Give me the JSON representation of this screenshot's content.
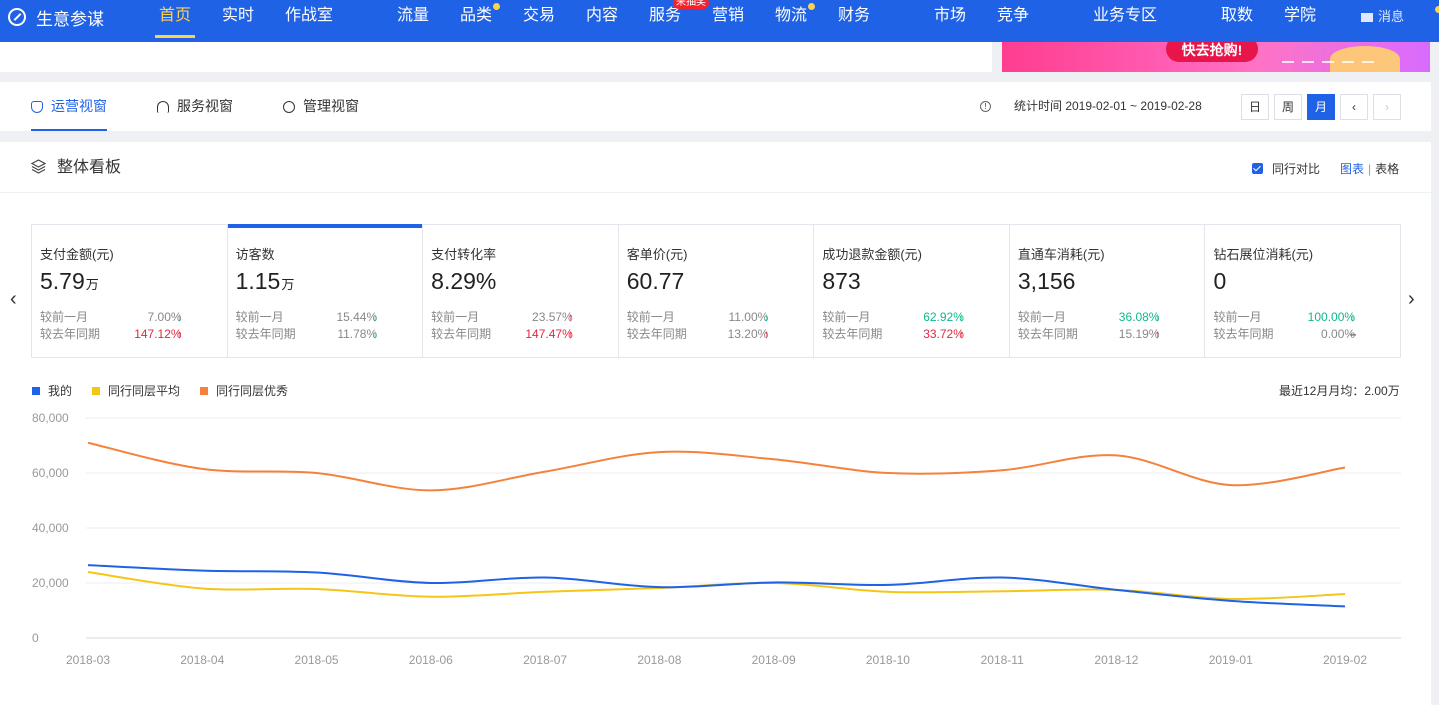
{
  "nav": {
    "brand": "生意参谋",
    "items": [
      {
        "label": "首页",
        "active": true
      },
      {
        "label": "实时"
      },
      {
        "label": "作战室"
      },
      {
        "label": "流量"
      },
      {
        "label": "品类",
        "dot": true
      },
      {
        "label": "交易"
      },
      {
        "label": "内容"
      },
      {
        "label": "服务",
        "badge": "来抽奖"
      },
      {
        "label": "营销"
      },
      {
        "label": "物流",
        "dot": true
      },
      {
        "label": "财务"
      },
      {
        "label": "市场"
      },
      {
        "label": "竞争"
      },
      {
        "label": "业务专区"
      },
      {
        "label": "取数"
      },
      {
        "label": "学院"
      }
    ],
    "message": "消息"
  },
  "banner": {
    "cta": "快去抢购!"
  },
  "view_tabs": [
    {
      "label": "运营视窗",
      "active": true,
      "icon": "shield-icon"
    },
    {
      "label": "服务视窗",
      "icon": "headset-icon"
    },
    {
      "label": "管理视窗",
      "icon": "medal-icon"
    }
  ],
  "stats_range": {
    "label": "统计时间 2019-02-01 ~ 2019-02-28",
    "periods": [
      "日",
      "周",
      "月"
    ],
    "active_period": "月"
  },
  "overview": {
    "title": "整体看板",
    "compare_label": "同行对比",
    "view_chart": "图表",
    "view_table": "表格",
    "separator": "|"
  },
  "metrics": [
    {
      "label": "支付金额(元)",
      "value": "5.79",
      "unit": "万",
      "mom_label": "较前一月",
      "mom": "7.00%",
      "mom_dir": "down",
      "mom_color": "gray",
      "yoy_label": "较去年同期",
      "yoy": "147.12%",
      "yoy_dir": "up",
      "yoy_color": "red"
    },
    {
      "label": "访客数",
      "value": "1.15",
      "unit": "万",
      "selected": true,
      "mom_label": "较前一月",
      "mom": "15.44%",
      "mom_dir": "down",
      "mom_color": "gray",
      "yoy_label": "较去年同期",
      "yoy": "11.78%",
      "yoy_dir": "down",
      "yoy_color": "gray"
    },
    {
      "label": "支付转化率",
      "value": "8.29%",
      "unit": "",
      "mom_label": "较前一月",
      "mom": "23.57%",
      "mom_dir": "up",
      "mom_color": "gray",
      "yoy_label": "较去年同期",
      "yoy": "147.47%",
      "yoy_dir": "up",
      "yoy_color": "red"
    },
    {
      "label": "客单价(元)",
      "value": "60.77",
      "unit": "",
      "mom_label": "较前一月",
      "mom": "11.00%",
      "mom_dir": "down",
      "mom_color": "gray",
      "yoy_label": "较去年同期",
      "yoy": "13.20%",
      "yoy_dir": "up",
      "yoy_color": "gray"
    },
    {
      "label": "成功退款金额(元)",
      "value": "873",
      "unit": "",
      "mom_label": "较前一月",
      "mom": "62.92%",
      "mom_dir": "down",
      "mom_color": "green",
      "yoy_label": "较去年同期",
      "yoy": "33.72%",
      "yoy_dir": "up",
      "yoy_color": "red"
    },
    {
      "label": "直通车消耗(元)",
      "value": "3,156",
      "unit": "",
      "mom_label": "较前一月",
      "mom": "36.08%",
      "mom_dir": "down",
      "mom_color": "green",
      "yoy_label": "较去年同期",
      "yoy": "15.19%",
      "yoy_dir": "up",
      "yoy_color": "gray"
    },
    {
      "label": "钻石展位消耗(元)",
      "value": "0",
      "unit": "",
      "mom_label": "较前一月",
      "mom": "100.00%",
      "mom_dir": "down",
      "mom_color": "green",
      "yoy_label": "较去年同期",
      "yoy": "0.00%",
      "yoy_dir": "flat",
      "yoy_color": "gray"
    }
  ],
  "avg_label": "最近12月月均：2.00万",
  "colors": {
    "accent": "#2062e6",
    "up": "#e4273e",
    "down": "#11b78c"
  },
  "chart_data": {
    "type": "line",
    "categories": [
      "2018-03",
      "2018-04",
      "2018-05",
      "2018-06",
      "2018-07",
      "2018-08",
      "2018-09",
      "2018-10",
      "2018-11",
      "2018-12",
      "2019-01",
      "2019-02"
    ],
    "ylim": [
      0,
      80000
    ],
    "yticks": [
      "0",
      "20,000",
      "40,000",
      "60,000",
      "80,000"
    ],
    "ytick_values": [
      0,
      20000,
      40000,
      60000,
      80000
    ],
    "grid": true,
    "legend": "top-left",
    "series": [
      {
        "name": "我的",
        "color": "#2062e6",
        "values": [
          26500,
          24500,
          23800,
          20000,
          22000,
          18500,
          20200,
          19300,
          22000,
          17500,
          13500,
          11500
        ]
      },
      {
        "name": "同行同层平均",
        "color": "#f5c518",
        "values": [
          24000,
          18000,
          17800,
          15000,
          16800,
          18200,
          20000,
          16800,
          17000,
          17500,
          14200,
          16000
        ]
      },
      {
        "name": "同行同层优秀",
        "color": "#f5813a",
        "values": [
          71000,
          61500,
          60000,
          53700,
          60500,
          67600,
          65000,
          60000,
          61000,
          66400,
          55600,
          62000
        ]
      }
    ]
  }
}
